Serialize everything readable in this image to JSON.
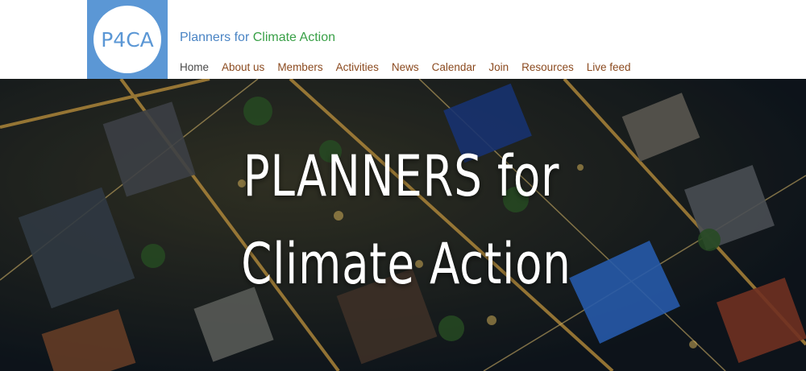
{
  "logo": {
    "text": "P4CA"
  },
  "site": {
    "title_part1": "Planners for ",
    "title_part2": "Climate Action"
  },
  "nav": {
    "items": [
      {
        "label": "Home"
      },
      {
        "label": "About us"
      },
      {
        "label": "Members"
      },
      {
        "label": "Activities"
      },
      {
        "label": "News"
      },
      {
        "label": "Calendar"
      },
      {
        "label": "Join"
      },
      {
        "label": "Resources"
      },
      {
        "label": "Live feed"
      }
    ]
  },
  "hero": {
    "line1": "PLANNERS for",
    "line2": "Climate Action"
  },
  "colors": {
    "logo_bg": "#5b97d5",
    "title_blue": "#4a84c4",
    "title_green": "#39a047",
    "nav_link": "#8b4a1f"
  }
}
